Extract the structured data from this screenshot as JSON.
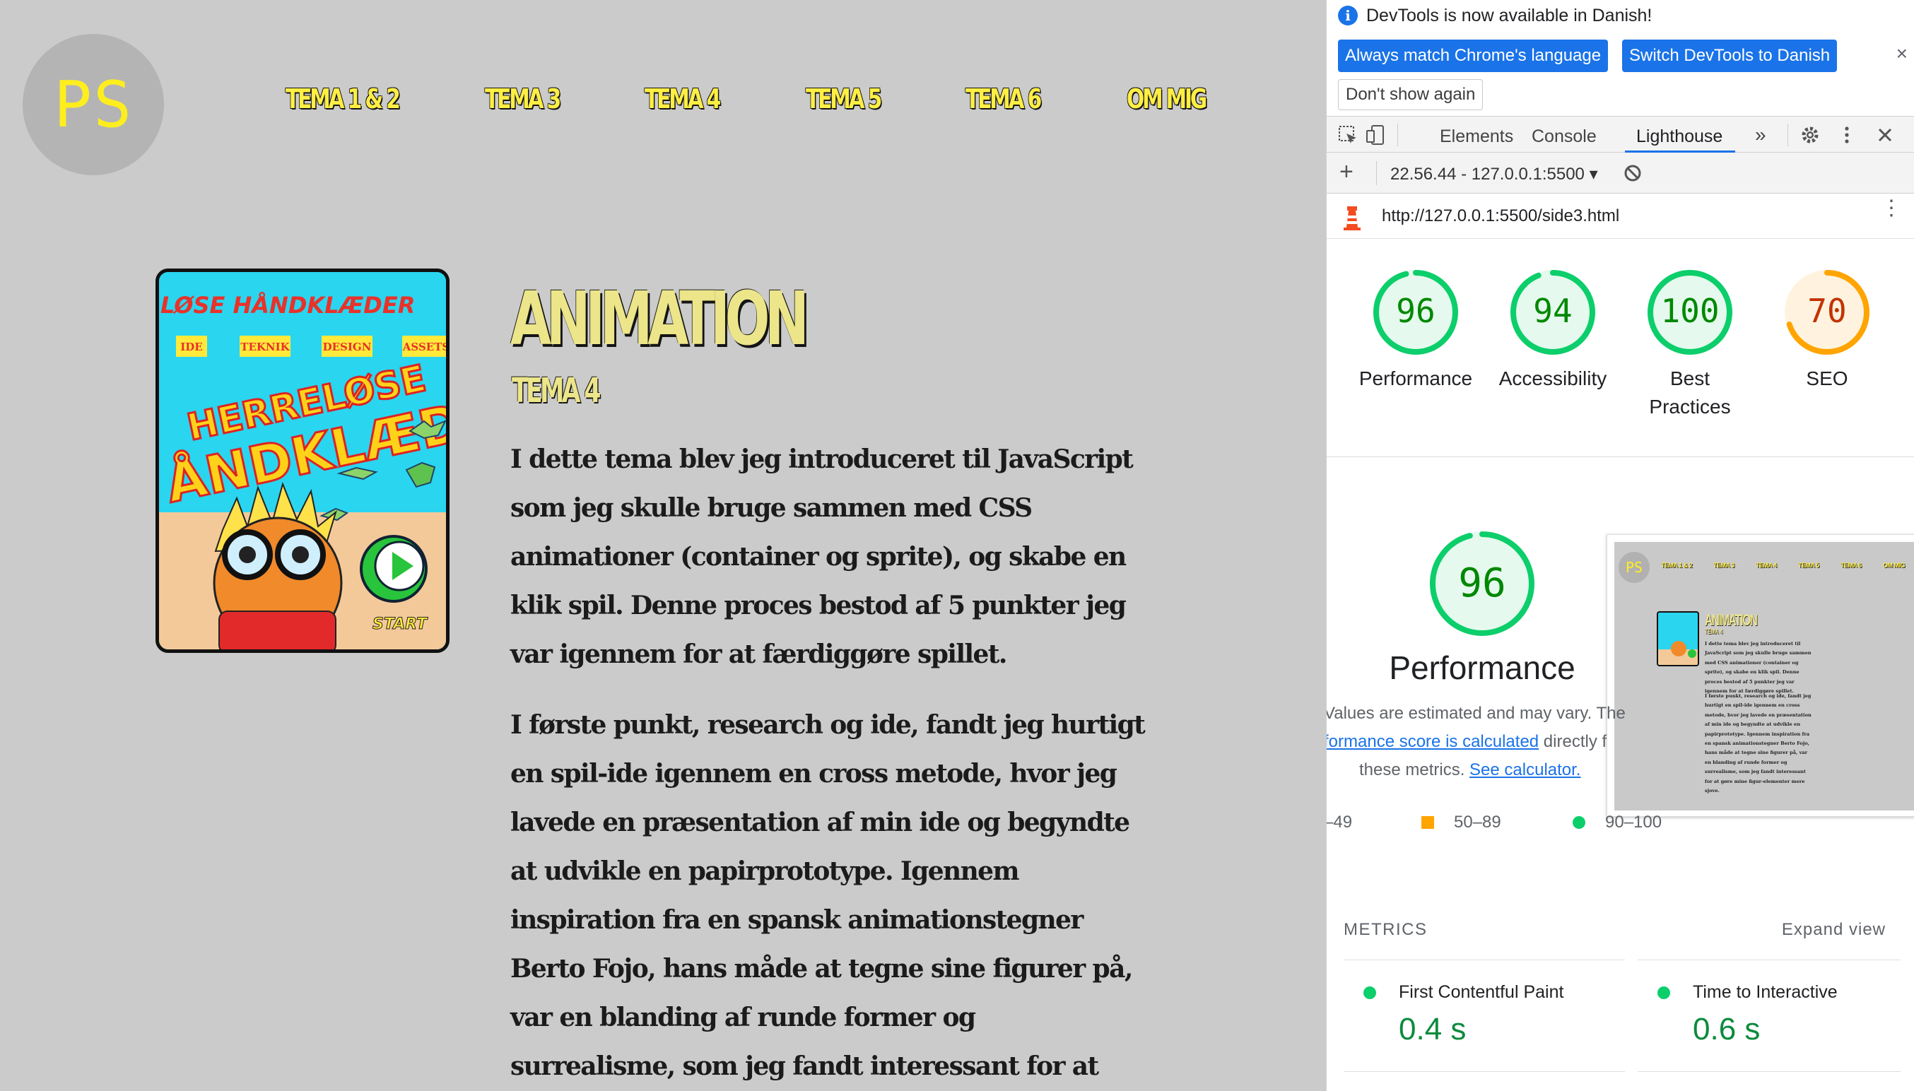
{
  "site": {
    "logo_text": "PS",
    "nav": [
      "TEMA 1 & 2",
      "TEMA 3",
      "TEMA 4",
      "TEMA 5",
      "TEMA 6",
      "OM MIG"
    ],
    "heading": "ANIMATION",
    "subheading": "TEMA 4",
    "paragraph1": "I dette tema blev jeg introduceret til JavaScript som jeg skulle bruge sammen med CSS animationer (container og sprite), og skabe en klik spil. Denne proces bestod af 5 punkter jeg var igennem for at færdiggøre spillet.",
    "paragraph2": "I første punkt, research og ide, fandt jeg hurtigt en spil-ide igennem en cross metode, hvor jeg lavede en præsentation af min ide og begyndte at udvikle en papirprototype. Igennem inspiration fra en spansk animationstegner Berto Fojo, hans måde at tegne sine figurer på, var en blanding af runde former og surrealisme, som jeg fandt interessant for at gøre mine figur-elementer mere sjove.",
    "thumbnail": {
      "top_title": "LØSE HÅNDKLÆDER",
      "menu": [
        "IDE",
        "TEKNIK",
        "DESIGN",
        "ASSETS"
      ],
      "game_title_1": "HERRELØSE",
      "game_title_2": "ÅNDKLÆDER",
      "start": "START"
    }
  },
  "devtools": {
    "notice": {
      "message": "DevTools is now available in Danish!",
      "btn_match": "Always match Chrome's language",
      "btn_switch": "Switch DevTools to Danish",
      "btn_dont_show": "Don't show again",
      "close": "×"
    },
    "tabs": [
      "Elements",
      "Console",
      "Lighthouse"
    ],
    "active_tab": "Lighthouse",
    "more_tabs": "»",
    "report_selector": "22.56.44 - 127.0.0.1:5500 ▾",
    "url": "http://127.0.0.1:5500/side3.html",
    "scores": [
      {
        "label": "Performance",
        "value": 96,
        "status": "pass"
      },
      {
        "label": "Accessibility",
        "value": 94,
        "status": "pass"
      },
      {
        "label": "Best\nPractices",
        "value": 100,
        "status": "pass"
      },
      {
        "label": "SEO",
        "value": 70,
        "status": "average"
      }
    ],
    "performance": {
      "score": 96,
      "title": "Performance",
      "note_line1": "Values are estimated and may vary. The",
      "note_link1": "formance score is calculated",
      "note_mid": " directly f",
      "note_line3_pre": "these metrics. ",
      "note_link2": "See calculator.",
      "legend": [
        "–49",
        "50–89",
        "90–100"
      ]
    },
    "metrics": {
      "heading": "METRICS",
      "expand": "Expand view",
      "items": [
        {
          "name": "First Contentful Paint",
          "value": "0.4 s"
        },
        {
          "name": "Time to Interactive",
          "value": "0.6 s"
        }
      ]
    },
    "colors": {
      "pass": "#0cce6b",
      "average": "#ffa400",
      "pass_text": "#008800",
      "average_text": "#c33300",
      "accent": "#1a73e8"
    }
  }
}
